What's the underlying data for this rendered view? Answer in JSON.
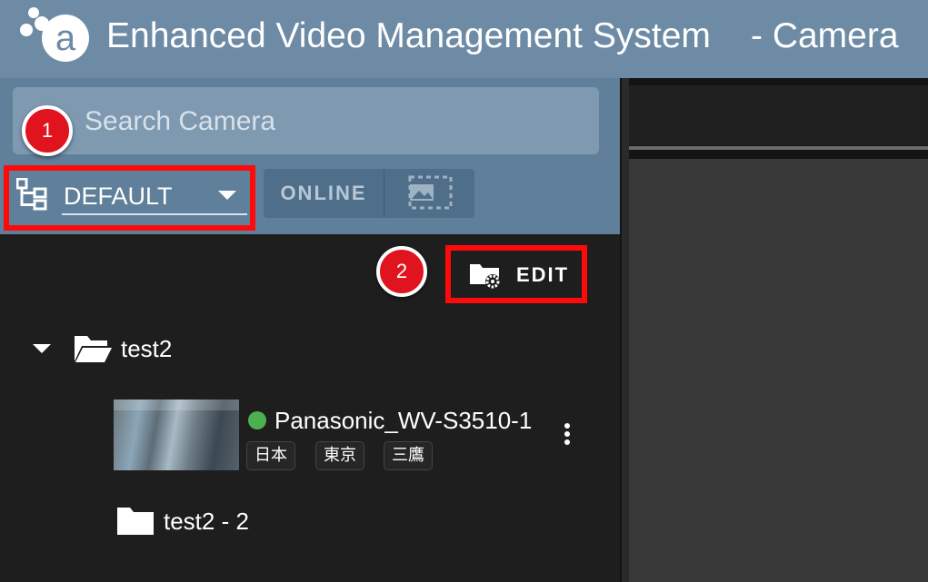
{
  "header": {
    "app_title": "Enhanced Video Management System",
    "page_title": "- Camera",
    "bg_color": "#6e8ba5"
  },
  "sidebar": {
    "search": {
      "placeholder": "Search Camera"
    },
    "group_select": {
      "value": "DEFAULT",
      "icon": "hierarchy-icon"
    },
    "view_toggle": {
      "online_label": "ONLINE",
      "thumbnail_icon": "thumbnail-icon"
    },
    "edit_button": {
      "label": "EDIT",
      "icon": "folder-settings-icon"
    },
    "tree": {
      "folders": [
        {
          "name": "test2",
          "expanded": true,
          "cameras": [
            {
              "name": "Panasonic_WV-S3510-1",
              "status": "online",
              "status_color": "#4caf50",
              "tags": [
                "日本",
                "東京",
                "三鷹"
              ]
            }
          ]
        },
        {
          "name": "test2 - 2",
          "expanded": false
        }
      ]
    }
  },
  "annotations": {
    "marker_1": "1",
    "marker_2": "2",
    "highlight_color": "#ff0a0a"
  }
}
